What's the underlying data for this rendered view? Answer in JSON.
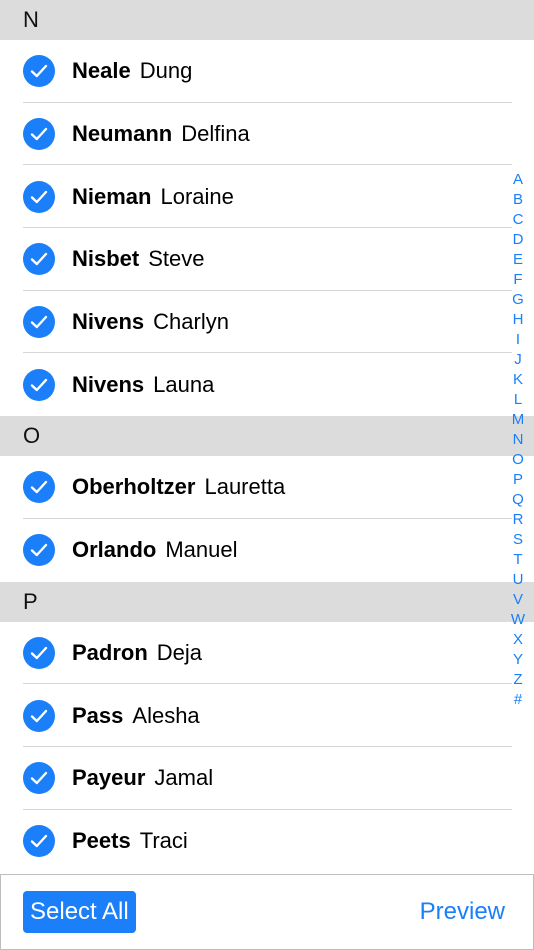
{
  "sections": [
    {
      "letter": "N",
      "contacts": [
        {
          "last": "Neale",
          "first": "Dung"
        },
        {
          "last": "Neumann",
          "first": "Delfina"
        },
        {
          "last": "Nieman",
          "first": "Loraine"
        },
        {
          "last": "Nisbet",
          "first": "Steve"
        },
        {
          "last": "Nivens",
          "first": "Charlyn"
        },
        {
          "last": "Nivens",
          "first": "Launa"
        }
      ]
    },
    {
      "letter": "O",
      "contacts": [
        {
          "last": "Oberholtzer",
          "first": "Lauretta"
        },
        {
          "last": "Orlando",
          "first": "Manuel"
        }
      ]
    },
    {
      "letter": "P",
      "contacts": [
        {
          "last": "Padron",
          "first": "Deja"
        },
        {
          "last": "Pass",
          "first": "Alesha"
        },
        {
          "last": "Payeur",
          "first": "Jamal"
        },
        {
          "last": "Peets",
          "first": "Traci"
        }
      ]
    }
  ],
  "index_letters": [
    "A",
    "B",
    "C",
    "D",
    "E",
    "F",
    "G",
    "H",
    "I",
    "J",
    "K",
    "L",
    "M",
    "N",
    "O",
    "P",
    "Q",
    "R",
    "S",
    "T",
    "U",
    "V",
    "W",
    "X",
    "Y",
    "Z",
    "#"
  ],
  "toolbar": {
    "select_all_label": "Select All",
    "preview_label": "Preview"
  },
  "colors": {
    "accent": "#1a7ff8",
    "section_header_bg": "#dcdcdc",
    "separator": "#d6d6d9"
  },
  "icons": {
    "row_check": "checkmark-circle-icon"
  }
}
